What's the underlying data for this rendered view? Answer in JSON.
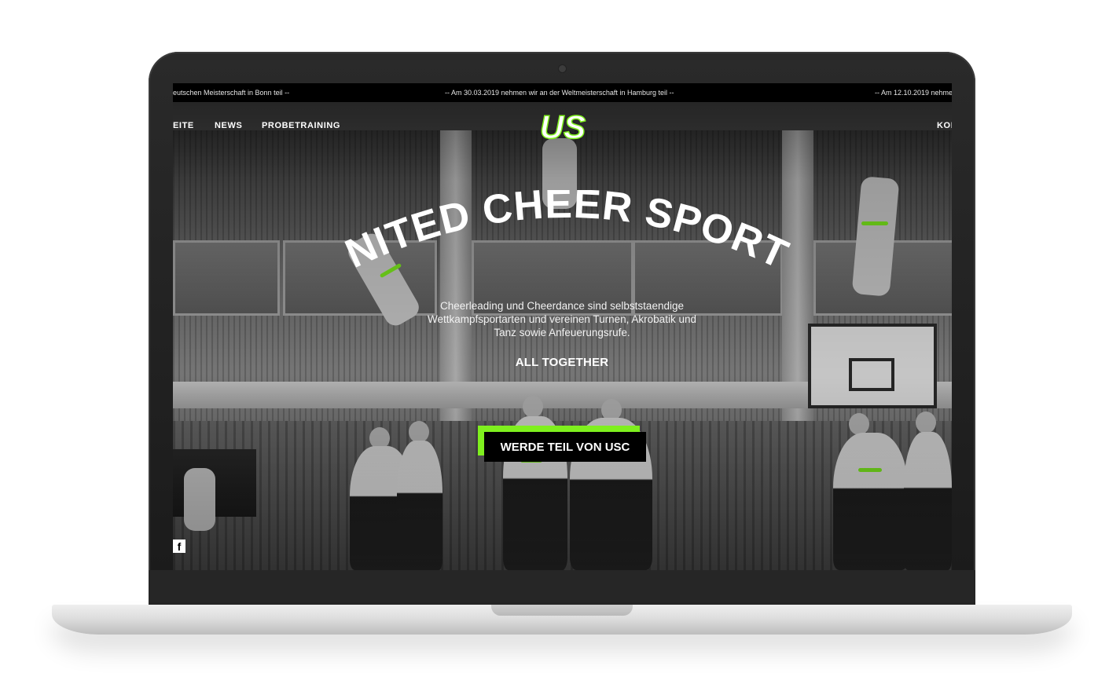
{
  "ticker": {
    "left": "eutschen Meisterschaft in Bonn teil --",
    "center": "-- Am 30.03.2019 nehmen wir an der Weltmeisterschaft in Hamburg teil --",
    "right": "-- Am 12.10.2019 nehme"
  },
  "nav": {
    "items": [
      "EITE",
      "NEWS",
      "PROBETRAINING"
    ],
    "right_item": "KON"
  },
  "logo": {
    "text": "US"
  },
  "hero": {
    "title": "UNITED CHEER SPORTS",
    "description_lines": [
      "Cheerleading und Cheerdance sind selbststaendige",
      "Wettkampfsportarten und vereinen Turnen, Akrobatik und",
      "Tanz sowie Anfeuerungsrufe."
    ],
    "tagline": "ALL TOGETHER",
    "cta_label": "WERDE TEIL VON USC"
  },
  "social": {
    "facebook_glyph": "f"
  },
  "colors": {
    "accent": "#7ff01e",
    "ticker_bg": "#000000",
    "cta_bg": "#000000",
    "device_frame": "#1f1f1f"
  }
}
